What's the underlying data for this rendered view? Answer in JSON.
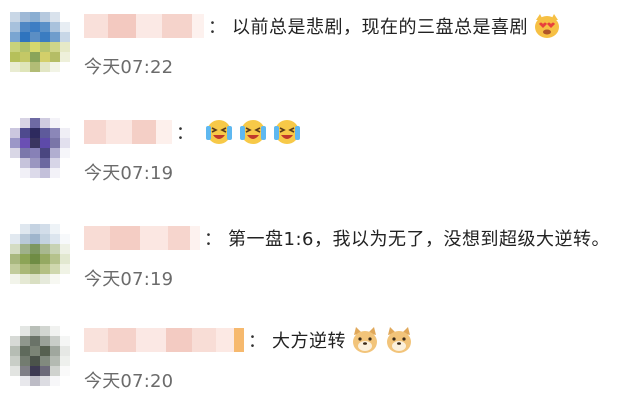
{
  "comments": [
    {
      "text": "以前总是悲剧，现在的三盘总是喜剧",
      "time": "今天07:22",
      "emojis": [
        "heart-eyes-dog-icon"
      ],
      "separator": "："
    },
    {
      "text": "",
      "time": "今天07:19",
      "emojis": [
        "crying-laughing-icon",
        "crying-laughing-icon",
        "crying-laughing-icon"
      ],
      "separator": "："
    },
    {
      "text": "第一盘1:6，我以为无了，没想到超级大逆转。",
      "time": "今天07:19",
      "emojis": [],
      "separator": "："
    },
    {
      "text": "大方逆转",
      "time": "今天07:20",
      "emojis": [
        "doge-icon",
        "doge-icon"
      ],
      "separator": "："
    }
  ],
  "colors": {
    "time": "#6b6b6b",
    "text": "#222222",
    "name_blur": "#f6d0c8"
  }
}
